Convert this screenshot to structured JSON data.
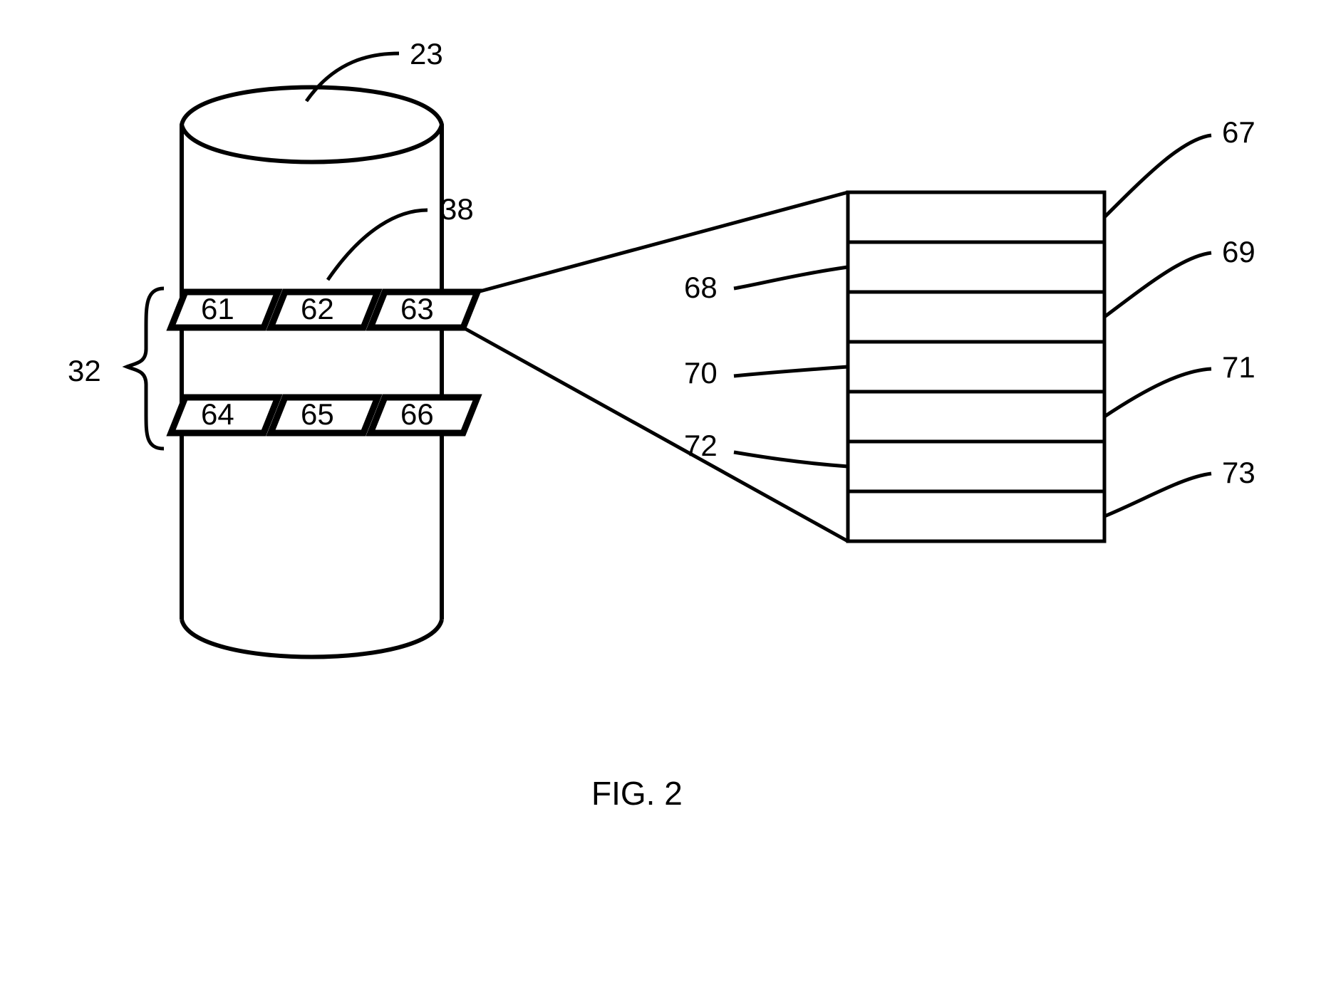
{
  "figure_caption": "FIG. 2",
  "labels": {
    "cylinder": "23",
    "pointer": "38",
    "array_brace": "32",
    "chip_61": "61",
    "chip_62": "62",
    "chip_63": "63",
    "chip_64": "64",
    "chip_65": "65",
    "chip_66": "66",
    "layer_top": "67",
    "layer_second": "68",
    "layer_third": "69",
    "layer_fourth": "70",
    "layer_fifth": "71",
    "layer_sixth": "72",
    "layer_seventh": "73"
  }
}
